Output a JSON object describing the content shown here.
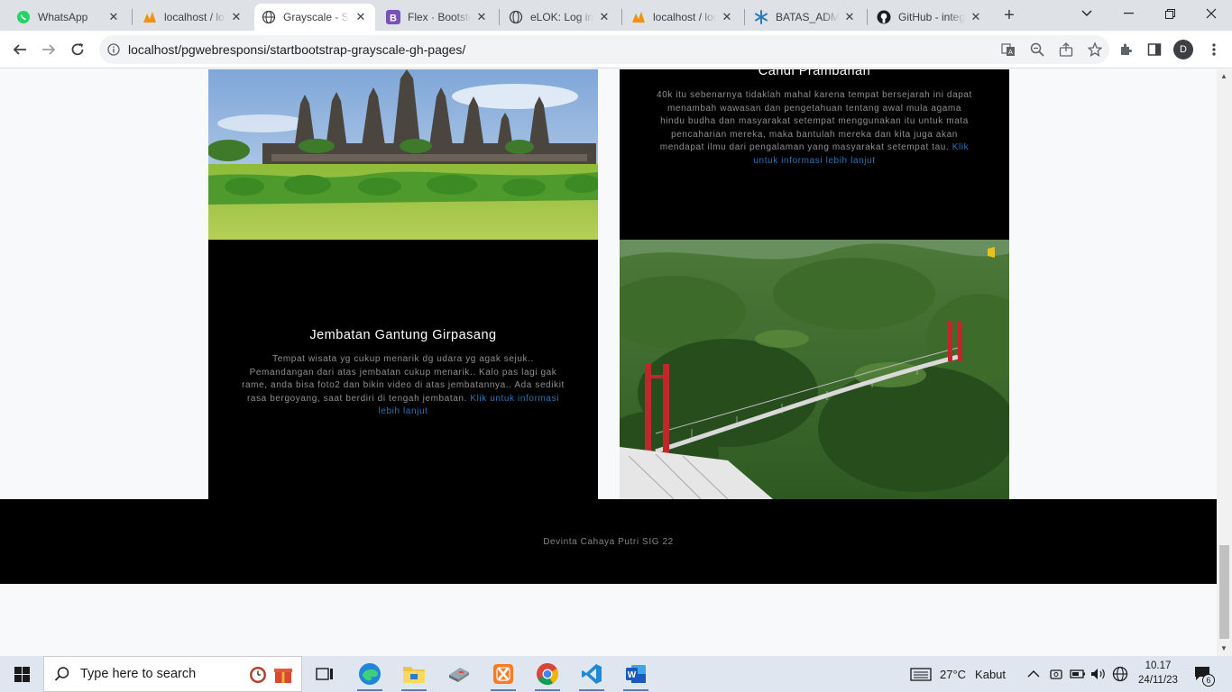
{
  "browser": {
    "tabs": [
      {
        "title": "WhatsApp",
        "icon": "whatsapp-icon",
        "color": "#25d366",
        "active": false
      },
      {
        "title": "localhost / localhost | phpMyAdmin",
        "icon": "phpmyadmin-icon",
        "color": "#f29111",
        "active": false
      },
      {
        "title": "Grayscale - Start Bootstrap Theme",
        "icon": "globe-icon",
        "color": "#3c4043",
        "active": true
      },
      {
        "title": "Flex · Bootstrap",
        "icon": "bootstrap-icon",
        "color": "#7952b3",
        "active": false
      },
      {
        "title": "eLOK: Log in to the site",
        "icon": "globe-icon",
        "color": "#3c4043",
        "active": false
      },
      {
        "title": "localhost / localhost | phpMyAdmin",
        "icon": "phpmyadmin-icon",
        "color": "#f29111",
        "active": false
      },
      {
        "title": "BATAS_ADMINISTRASI",
        "icon": "snowflake-icon",
        "color": "#2b7bb9",
        "active": false
      },
      {
        "title": "GitHub - integration",
        "icon": "github-icon",
        "color": "#1b1f23",
        "active": false
      }
    ],
    "url": "localhost/pgwebresponsi/startbootstrap-grayscale-gh-pages/",
    "profile_initial": "D"
  },
  "page": {
    "cards": [
      {
        "title": "Candi Prambanan",
        "body": "40k itu sebenarnya tidaklah mahal karena tempat bersejarah ini dapat menambah wawasan dan pengetahuan tentang awal mula agama hindu budha dan masyarakat setempat menggunakan itu untuk mata pencaharian mereka, maka bantulah mereka dan kita juga akan mendapat ilmu dari pengalaman yang masyarakat setempat tau.",
        "link": "Klik untuk informasi lebih lanjut"
      },
      {
        "title": "Jembatan Gantung Girpasang",
        "body": "Tempat wisata yg cukup menarik dg udara yg agak sejuk.. Pemandangan dari atas jembatan cukup menarik.. Kalo pas lagi gak rame, anda bisa foto2 dan bikin video di atas jembatannya.. Ada sedikit rasa bergoyang, saat berdiri di tengah jembatan.",
        "link": "Klik untuk informasi lebih lanjut"
      }
    ],
    "footer": "Devinta Cahaya Putri SIG 22"
  },
  "taskbar": {
    "search_placeholder": "Type here to search",
    "weather": {
      "temp": "27°C",
      "condition": "Kabut"
    },
    "clock": {
      "time": "10.17",
      "date": "24/11/23"
    },
    "notifications": "6",
    "apps": [
      "task-view-icon",
      "edge-icon",
      "file-explorer-icon",
      "storage-app-icon",
      "xampp-icon",
      "chrome-icon",
      "vscode-icon",
      "word-icon"
    ]
  }
}
